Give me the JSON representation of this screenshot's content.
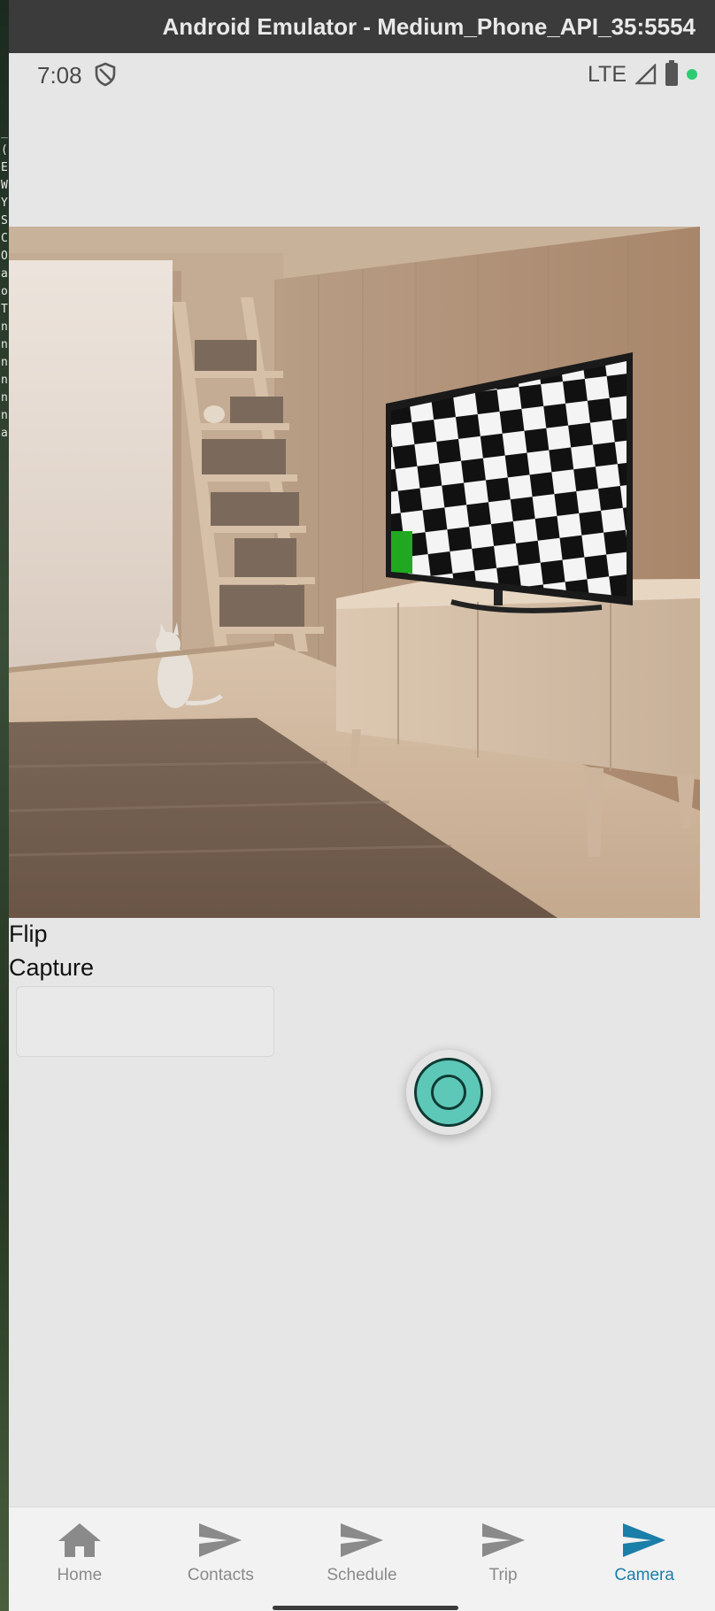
{
  "window": {
    "title": "Android Emulator - Medium_Phone_API_35:5554"
  },
  "status_bar": {
    "time": "7:08",
    "network": "LTE",
    "icons": [
      "shield-icon",
      "signal-icon",
      "battery-icon",
      "status-dot-icon"
    ],
    "dot_color": "#2ecc71"
  },
  "camera": {
    "flip_label": "Flip",
    "capture_label": "Capture",
    "text_box_value": "",
    "shutter_color": "#5ec8b8"
  },
  "bottom_nav": {
    "active_color": "#1a7fa8",
    "items": [
      {
        "label": "Home",
        "icon": "home-icon"
      },
      {
        "label": "Contacts",
        "icon": "send-icon"
      },
      {
        "label": "Schedule",
        "icon": "send-icon"
      },
      {
        "label": "Trip",
        "icon": "send-icon"
      },
      {
        "label": "Camera",
        "icon": "send-icon",
        "active": true
      }
    ]
  },
  "background_strip_text": [
    "_",
    "(",
    "E",
    "W",
    "Y",
    "S",
    "C",
    "O",
    "a",
    "o",
    "T",
    "n",
    "n",
    "n",
    "n",
    "n",
    "n",
    "a"
  ]
}
